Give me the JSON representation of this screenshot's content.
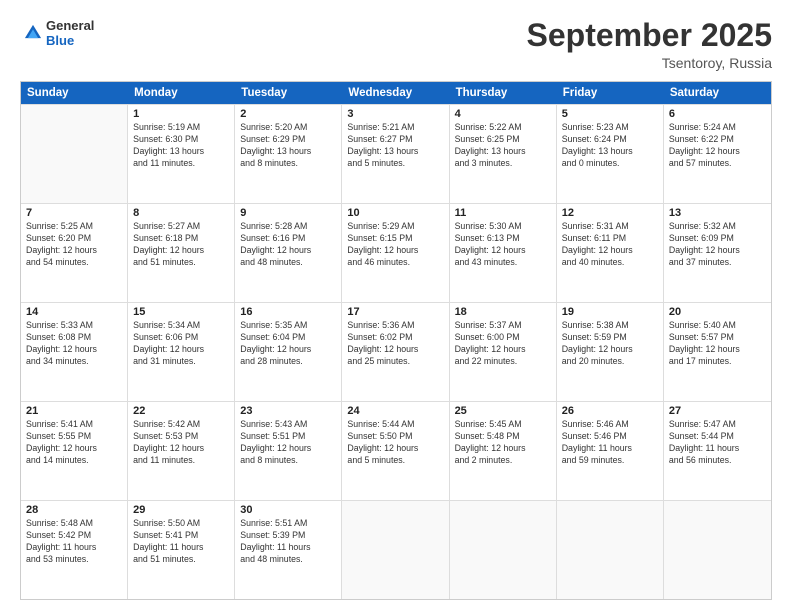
{
  "logo": {
    "general": "General",
    "blue": "Blue"
  },
  "title": {
    "month": "September 2025",
    "location": "Tsentoroy, Russia"
  },
  "header": {
    "days": [
      "Sunday",
      "Monday",
      "Tuesday",
      "Wednesday",
      "Thursday",
      "Friday",
      "Saturday"
    ]
  },
  "weeks": [
    [
      {
        "day": "",
        "info": ""
      },
      {
        "day": "1",
        "info": "Sunrise: 5:19 AM\nSunset: 6:30 PM\nDaylight: 13 hours\nand 11 minutes."
      },
      {
        "day": "2",
        "info": "Sunrise: 5:20 AM\nSunset: 6:29 PM\nDaylight: 13 hours\nand 8 minutes."
      },
      {
        "day": "3",
        "info": "Sunrise: 5:21 AM\nSunset: 6:27 PM\nDaylight: 13 hours\nand 5 minutes."
      },
      {
        "day": "4",
        "info": "Sunrise: 5:22 AM\nSunset: 6:25 PM\nDaylight: 13 hours\nand 3 minutes."
      },
      {
        "day": "5",
        "info": "Sunrise: 5:23 AM\nSunset: 6:24 PM\nDaylight: 13 hours\nand 0 minutes."
      },
      {
        "day": "6",
        "info": "Sunrise: 5:24 AM\nSunset: 6:22 PM\nDaylight: 12 hours\nand 57 minutes."
      }
    ],
    [
      {
        "day": "7",
        "info": "Sunrise: 5:25 AM\nSunset: 6:20 PM\nDaylight: 12 hours\nand 54 minutes."
      },
      {
        "day": "8",
        "info": "Sunrise: 5:27 AM\nSunset: 6:18 PM\nDaylight: 12 hours\nand 51 minutes."
      },
      {
        "day": "9",
        "info": "Sunrise: 5:28 AM\nSunset: 6:16 PM\nDaylight: 12 hours\nand 48 minutes."
      },
      {
        "day": "10",
        "info": "Sunrise: 5:29 AM\nSunset: 6:15 PM\nDaylight: 12 hours\nand 46 minutes."
      },
      {
        "day": "11",
        "info": "Sunrise: 5:30 AM\nSunset: 6:13 PM\nDaylight: 12 hours\nand 43 minutes."
      },
      {
        "day": "12",
        "info": "Sunrise: 5:31 AM\nSunset: 6:11 PM\nDaylight: 12 hours\nand 40 minutes."
      },
      {
        "day": "13",
        "info": "Sunrise: 5:32 AM\nSunset: 6:09 PM\nDaylight: 12 hours\nand 37 minutes."
      }
    ],
    [
      {
        "day": "14",
        "info": "Sunrise: 5:33 AM\nSunset: 6:08 PM\nDaylight: 12 hours\nand 34 minutes."
      },
      {
        "day": "15",
        "info": "Sunrise: 5:34 AM\nSunset: 6:06 PM\nDaylight: 12 hours\nand 31 minutes."
      },
      {
        "day": "16",
        "info": "Sunrise: 5:35 AM\nSunset: 6:04 PM\nDaylight: 12 hours\nand 28 minutes."
      },
      {
        "day": "17",
        "info": "Sunrise: 5:36 AM\nSunset: 6:02 PM\nDaylight: 12 hours\nand 25 minutes."
      },
      {
        "day": "18",
        "info": "Sunrise: 5:37 AM\nSunset: 6:00 PM\nDaylight: 12 hours\nand 22 minutes."
      },
      {
        "day": "19",
        "info": "Sunrise: 5:38 AM\nSunset: 5:59 PM\nDaylight: 12 hours\nand 20 minutes."
      },
      {
        "day": "20",
        "info": "Sunrise: 5:40 AM\nSunset: 5:57 PM\nDaylight: 12 hours\nand 17 minutes."
      }
    ],
    [
      {
        "day": "21",
        "info": "Sunrise: 5:41 AM\nSunset: 5:55 PM\nDaylight: 12 hours\nand 14 minutes."
      },
      {
        "day": "22",
        "info": "Sunrise: 5:42 AM\nSunset: 5:53 PM\nDaylight: 12 hours\nand 11 minutes."
      },
      {
        "day": "23",
        "info": "Sunrise: 5:43 AM\nSunset: 5:51 PM\nDaylight: 12 hours\nand 8 minutes."
      },
      {
        "day": "24",
        "info": "Sunrise: 5:44 AM\nSunset: 5:50 PM\nDaylight: 12 hours\nand 5 minutes."
      },
      {
        "day": "25",
        "info": "Sunrise: 5:45 AM\nSunset: 5:48 PM\nDaylight: 12 hours\nand 2 minutes."
      },
      {
        "day": "26",
        "info": "Sunrise: 5:46 AM\nSunset: 5:46 PM\nDaylight: 11 hours\nand 59 minutes."
      },
      {
        "day": "27",
        "info": "Sunrise: 5:47 AM\nSunset: 5:44 PM\nDaylight: 11 hours\nand 56 minutes."
      }
    ],
    [
      {
        "day": "28",
        "info": "Sunrise: 5:48 AM\nSunset: 5:42 PM\nDaylight: 11 hours\nand 53 minutes."
      },
      {
        "day": "29",
        "info": "Sunrise: 5:50 AM\nSunset: 5:41 PM\nDaylight: 11 hours\nand 51 minutes."
      },
      {
        "day": "30",
        "info": "Sunrise: 5:51 AM\nSunset: 5:39 PM\nDaylight: 11 hours\nand 48 minutes."
      },
      {
        "day": "",
        "info": ""
      },
      {
        "day": "",
        "info": ""
      },
      {
        "day": "",
        "info": ""
      },
      {
        "day": "",
        "info": ""
      }
    ]
  ]
}
